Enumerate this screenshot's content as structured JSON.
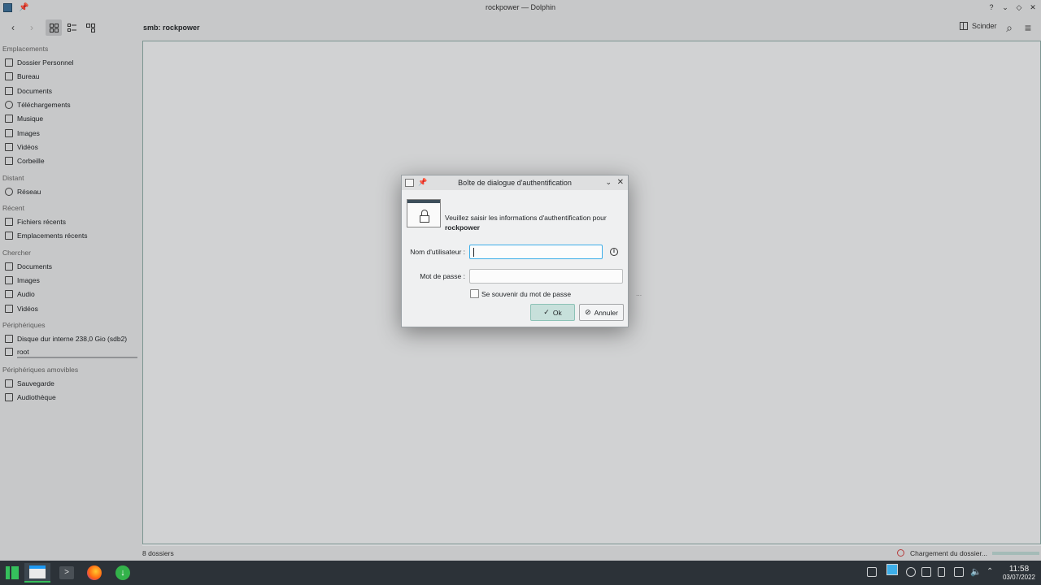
{
  "window": {
    "title": "rockpower — Dolphin",
    "help": "?",
    "minimize": "⌄",
    "maximize": "◇",
    "close": "✕"
  },
  "toolbar": {
    "back": "‹",
    "forward": "›",
    "path": "smb: rockpower",
    "split_label": "Scinder",
    "search": "⌕",
    "menu": "≡"
  },
  "sidebar": {
    "sections": [
      {
        "title": "Emplacements"
      },
      {
        "title": "Distant"
      },
      {
        "title": "Récent"
      },
      {
        "title": "Chercher"
      },
      {
        "title": "Périphériques"
      },
      {
        "title": "Périphériques amovibles"
      }
    ],
    "places": [
      "Dossier Personnel",
      "Bureau",
      "Documents",
      "Téléchargements",
      "Musique",
      "Images",
      "Vidéos",
      "Corbeille"
    ],
    "remote": [
      "Réseau"
    ],
    "recent": [
      "Fichiers récents",
      "Emplacements récents"
    ],
    "search": [
      "Documents",
      "Images",
      "Audio",
      "Vidéos"
    ],
    "devices": [
      "Disque dur interne 238,0 Gio (sdb2)",
      "root"
    ],
    "removable": [
      "Sauvegarde",
      "Audiothèque"
    ]
  },
  "content": {
    "background_fragment": "..."
  },
  "statusbar": {
    "count": "8 dossiers",
    "loading": "Chargement du dossier..."
  },
  "dialog": {
    "title": "Boîte de dialogue d'authentification",
    "message": "Veuillez saisir les informations d'authentification pour",
    "host": "rockpower",
    "username_label": "Nom d'utilisateur :",
    "username_value": "",
    "password_label": "Mot de passe :",
    "password_value": "",
    "remember_label": "Se souvenir du mot de passe",
    "ok_label": "Ok",
    "cancel_label": "Annuler"
  },
  "taskbar": {
    "terminal_glyph": ">",
    "download_glyph": "↓",
    "time": "11:58",
    "date": "03/07/2022"
  },
  "colors": {
    "accent": "#3daee9",
    "primary_button": "#c7e0db",
    "taskbar": "#2c3238",
    "manjaro": "#35bf5c"
  }
}
